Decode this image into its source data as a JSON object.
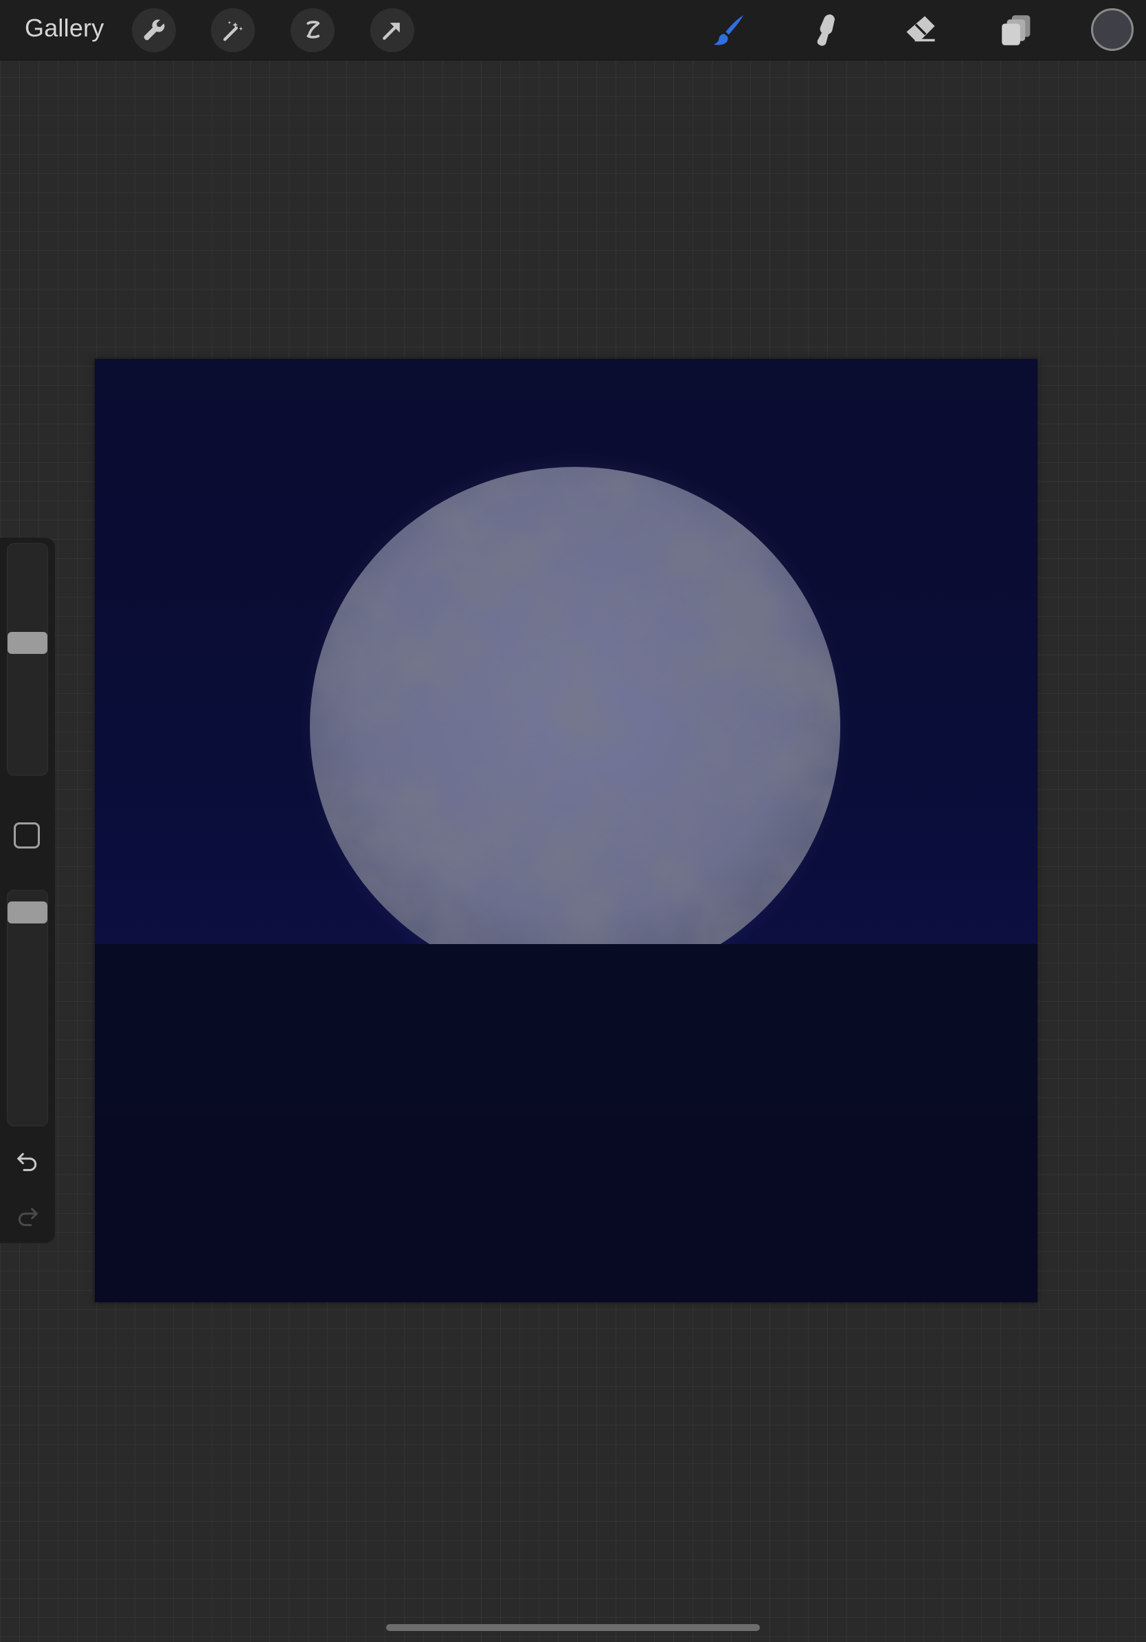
{
  "toolbar": {
    "gallery_label": "Gallery",
    "left_tools": [
      "wrench-icon",
      "magic-wand-icon",
      "selection-icon",
      "transform-arrow-icon"
    ],
    "right_tools": [
      "brush-icon",
      "smudge-icon",
      "eraser-icon",
      "layers-icon"
    ],
    "active_tool": "brush-icon",
    "active_color": "#3e3f47",
    "accent": "#2f6fe0"
  },
  "sidebar": {
    "brush_size_level": 0.58,
    "opacity_level": 0.95,
    "controls": [
      "brush-size-slider",
      "modify-button",
      "opacity-slider",
      "undo-icon",
      "redo-icon"
    ]
  },
  "canvas": {
    "sky_color": "#0a0d38",
    "moon_color": "#6e7190",
    "ground_color": "#080b24"
  }
}
